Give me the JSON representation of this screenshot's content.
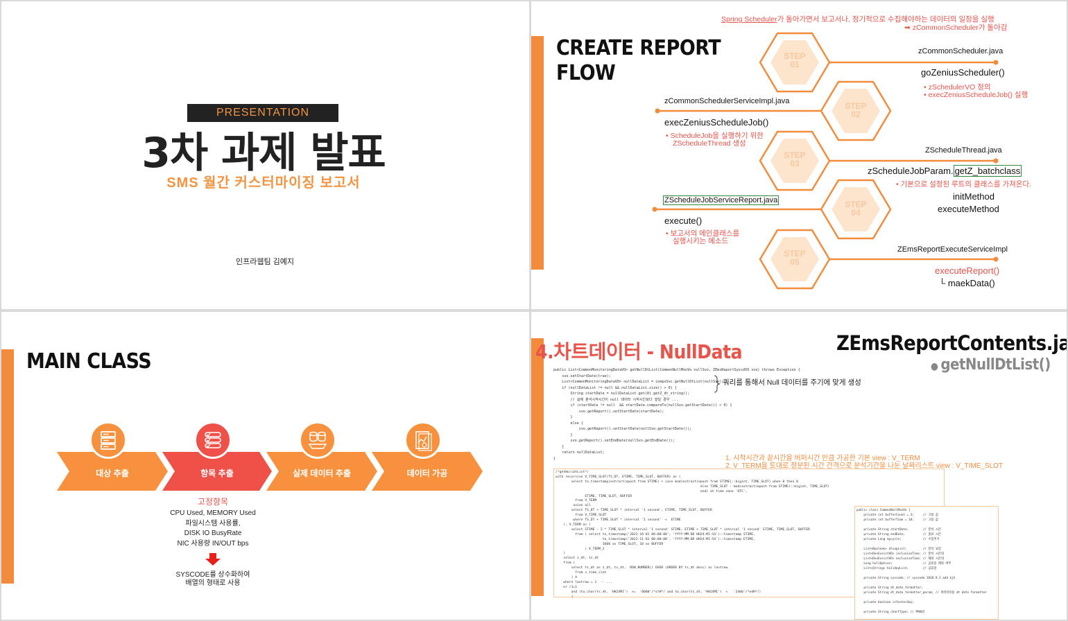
{
  "slide1": {
    "badge": "PRESENTATION",
    "title": "3차 과제 발표",
    "subtitle": "SMS 월간 커스터마이징 보고서",
    "author": "인프라웹팀 김예지"
  },
  "slide2": {
    "title_line1": "CREATE REPORT",
    "title_line2": "FLOW",
    "top_note_line1_link": "Spring Scheduler",
    "top_note_line1_rest": "가 돌아가면서 보고서나, 정기적으로 수집해야하는 데이터의 일정을 실행",
    "top_note_line2": "➡ zCommonScheduler가 돌아감",
    "steps": [
      {
        "label": "STEP",
        "num": "01"
      },
      {
        "label": "STEP",
        "num": "02"
      },
      {
        "label": "STEP",
        "num": "03"
      },
      {
        "label": "STEP",
        "num": "04"
      },
      {
        "label": "STEP",
        "num": "05"
      }
    ],
    "step1_file": "zCommonScheduler.java",
    "step1_method": "goZeniusScheduler()",
    "step1_note1": "zSchedulerVO 정의",
    "step1_note2": "execZeniusScheduleJob() 실행",
    "step2_file": "zCommonSchedulerServiceImpl.java",
    "step2_method": "execZeniusScheduleJob()",
    "step2_note1": "ScheduleJob을 실행하기 위한",
    "step2_note2": "ZScheduleThread 생성",
    "step3_file": "ZScheduleThread.java",
    "step3_method_a": "zScheduleJobParam.",
    "step3_method_b": "getZ_batchclass",
    "step3_note": "기본으로 설정된 루트의 클래스를 가져온다.",
    "step3_m2": "initMethod",
    "step3_m3": "executeMethod",
    "step4_file": "ZScheduleJobServiceReport.java",
    "step4_method": "execute()",
    "step4_note1": "보고서의 메인클래스를",
    "step4_note2": "실행시키는 메소드",
    "step5_file": "ZEmsReportExecuteServiceImpl",
    "step5_method": "executeReport()",
    "step5_sub": "└  maekData()",
    "colors": {
      "accent": "#f28c3c",
      "hex_fill": "#fde4cc",
      "hex_text": "#f6c9a0",
      "note": "#e8534a"
    }
  },
  "slide3": {
    "title": "MAIN CLASS",
    "steps": [
      {
        "label": "대상 추출",
        "icon": "server-icon"
      },
      {
        "label": "항목 추출",
        "icon": "checklist-icon"
      },
      {
        "label": "실제 데이터 추출",
        "icon": "database-icon"
      },
      {
        "label": "데이터 가공",
        "icon": "report-icon"
      }
    ],
    "fixed_title": "고정항목",
    "fixed_items": [
      "CPU Used, MEMORY Used",
      "파일시스템 사용률,",
      "DISK IO BusyRate",
      "NIC 사용량 IN/OUT bps"
    ],
    "result_line1": "SYSCODE를 상수화하여",
    "result_line2": "배열의 형태로 사용"
  },
  "slide4": {
    "title_num": "4.",
    "title_text": "차트데이터 - NullData",
    "class_name": "ZEmsReportContents.java",
    "method_name": "getNullDtList()",
    "callout1": "쿼리를 통해서 Null 데이터를 주기에 맞게 생성",
    "callout2_line1": "1. 시작시간과 끝시간을 버퍼시간 만큼 가공한 기본 view : V_TERM",
    "callout2_line2": "2. V_TERM을 토대로 정분된 시간 간격으로 분석기간을 나눈 날짜리스트 view : V_TIME_SLOT",
    "code1": "public List<CommonMonitoringDataVO> getNullDtList(CommonNullMonVo nullSvo, ZEmsReportSyscdVO svo) throws Exception {\n    svo.setStartDate(true);\n    List<CommonMonitoringDataVO> nullDataList = compoSvc.getNullDtList(nullSvo);\n    if (nullDataList != null && nullDataList.size() > 0) {\n        String startDate = nullDataList.get(0).getZ_dt_string();\n        // 실제 분석시작시간이 null 데이터 시작시간보다 앞일 경우 ...\n        if (startDate != null  && startDate.compareTo(nullSvo.getStartDate()) < 0) {\n            svo.getReport().setStartDate(startDate);\n        }\n        else {\n            svo.getReport().setStartDate(nullSvo.getStartDate());\n        }\n        svo.getReport().setEndDate(nullSvo.getEndDate());\n    }\n    return nullDataList;\n}",
    "code2": "/*getNullDtList*/\nwith recursive V_TIME_SLOT(TS_DT, ETIME, TIME_SLOT, BUFFER) as (\n        select to_timestamp(extract(epoch from STIME) + case mod(extract(epoch from STIME)::bigint, TIME_SLOT) when 0 then 0\n                                                                          else TIME_SLOT - mod(extract(epoch from STIME)::bigint, TIME_SLOT)\n                                                                          end) at time zone 'UTC',\n               ETIME, TIME_SLOT, BUFFER\n          from V_TERM\n         union all\n        select TS_DT + TIME_SLOT * interval '1 second', ETIME, TIME_SLOT, BUFFER\n          from V_TIME_SLOT\n         where TS_DT + TIME_SLOT * interval '1 second'  <  ETIME\n    ), V_TERM as (\n        select STIME - 2 * TIME_SLOT * interval '1 second' STIME, ETIME + TIME_SLOT * interval '1 second' ETIME, TIME_SLOT, BUFFER\n          from ( select to_timestamp('2022-10-01 00:00:00', 'YYYY-MM-DD HH24:MI:SS')::timestamp STIME,\n                        to_timestamp('2022-11-01 00:00:00', 'YYYY-MM-DD HH24:MI:SS')::timestamp ETIME,\n                        3600 as TIME_SLOT, 10 as BUFFER\n               ) V_TERM_2\n    )\n    select z_dt, ts_dt\n    from (\n        select ts_dt as z_dt, ts_dt,  ROW_NUMBER() OVER (ORDER BY ts_dt desc) as lastrow\n          from v_time_slot\n        ) A\n    where lastrow = 1  -- ...\n    or (1=1\n        and (to_char(ts_dt, 'HH24MI')  >=  '0000'/*stH*/ and to_char(ts_dt, 'HH24MI')  <   '2400'/*edH*/)\n        )",
    "code3": "public class CommonNullMonVo {\n    private int bufferCount = 3;     // 고정 값\n    private int bufferTime = 10;     // 고정 값\n\n    private String startDate;        // 분석 시간\n    private String endDate;          // 종료 시간\n    private Long mycycle;            // 수집주기\n\n    List<Boolean> dlsopList;         // 분석 요일\n    List<DevExsistVO> inclusionTime; // 분석 시간대\n    List<DevExsistVO> exclusionTime; // 제외 시간대\n    Long holiOption;                 // 공휴일 제외 여부\n    List<String> holidayList;        // 공휴일\n\n    private String syscode; // syscode 2018.9.3 add kjh\n\n    private String dt_date_formatter;\n    private String dt_date_formatter_param; // 파라미터용 dt date formatter\n\n    private boolean isYesterday;\n\n    private String chartType; // PM465"
  }
}
